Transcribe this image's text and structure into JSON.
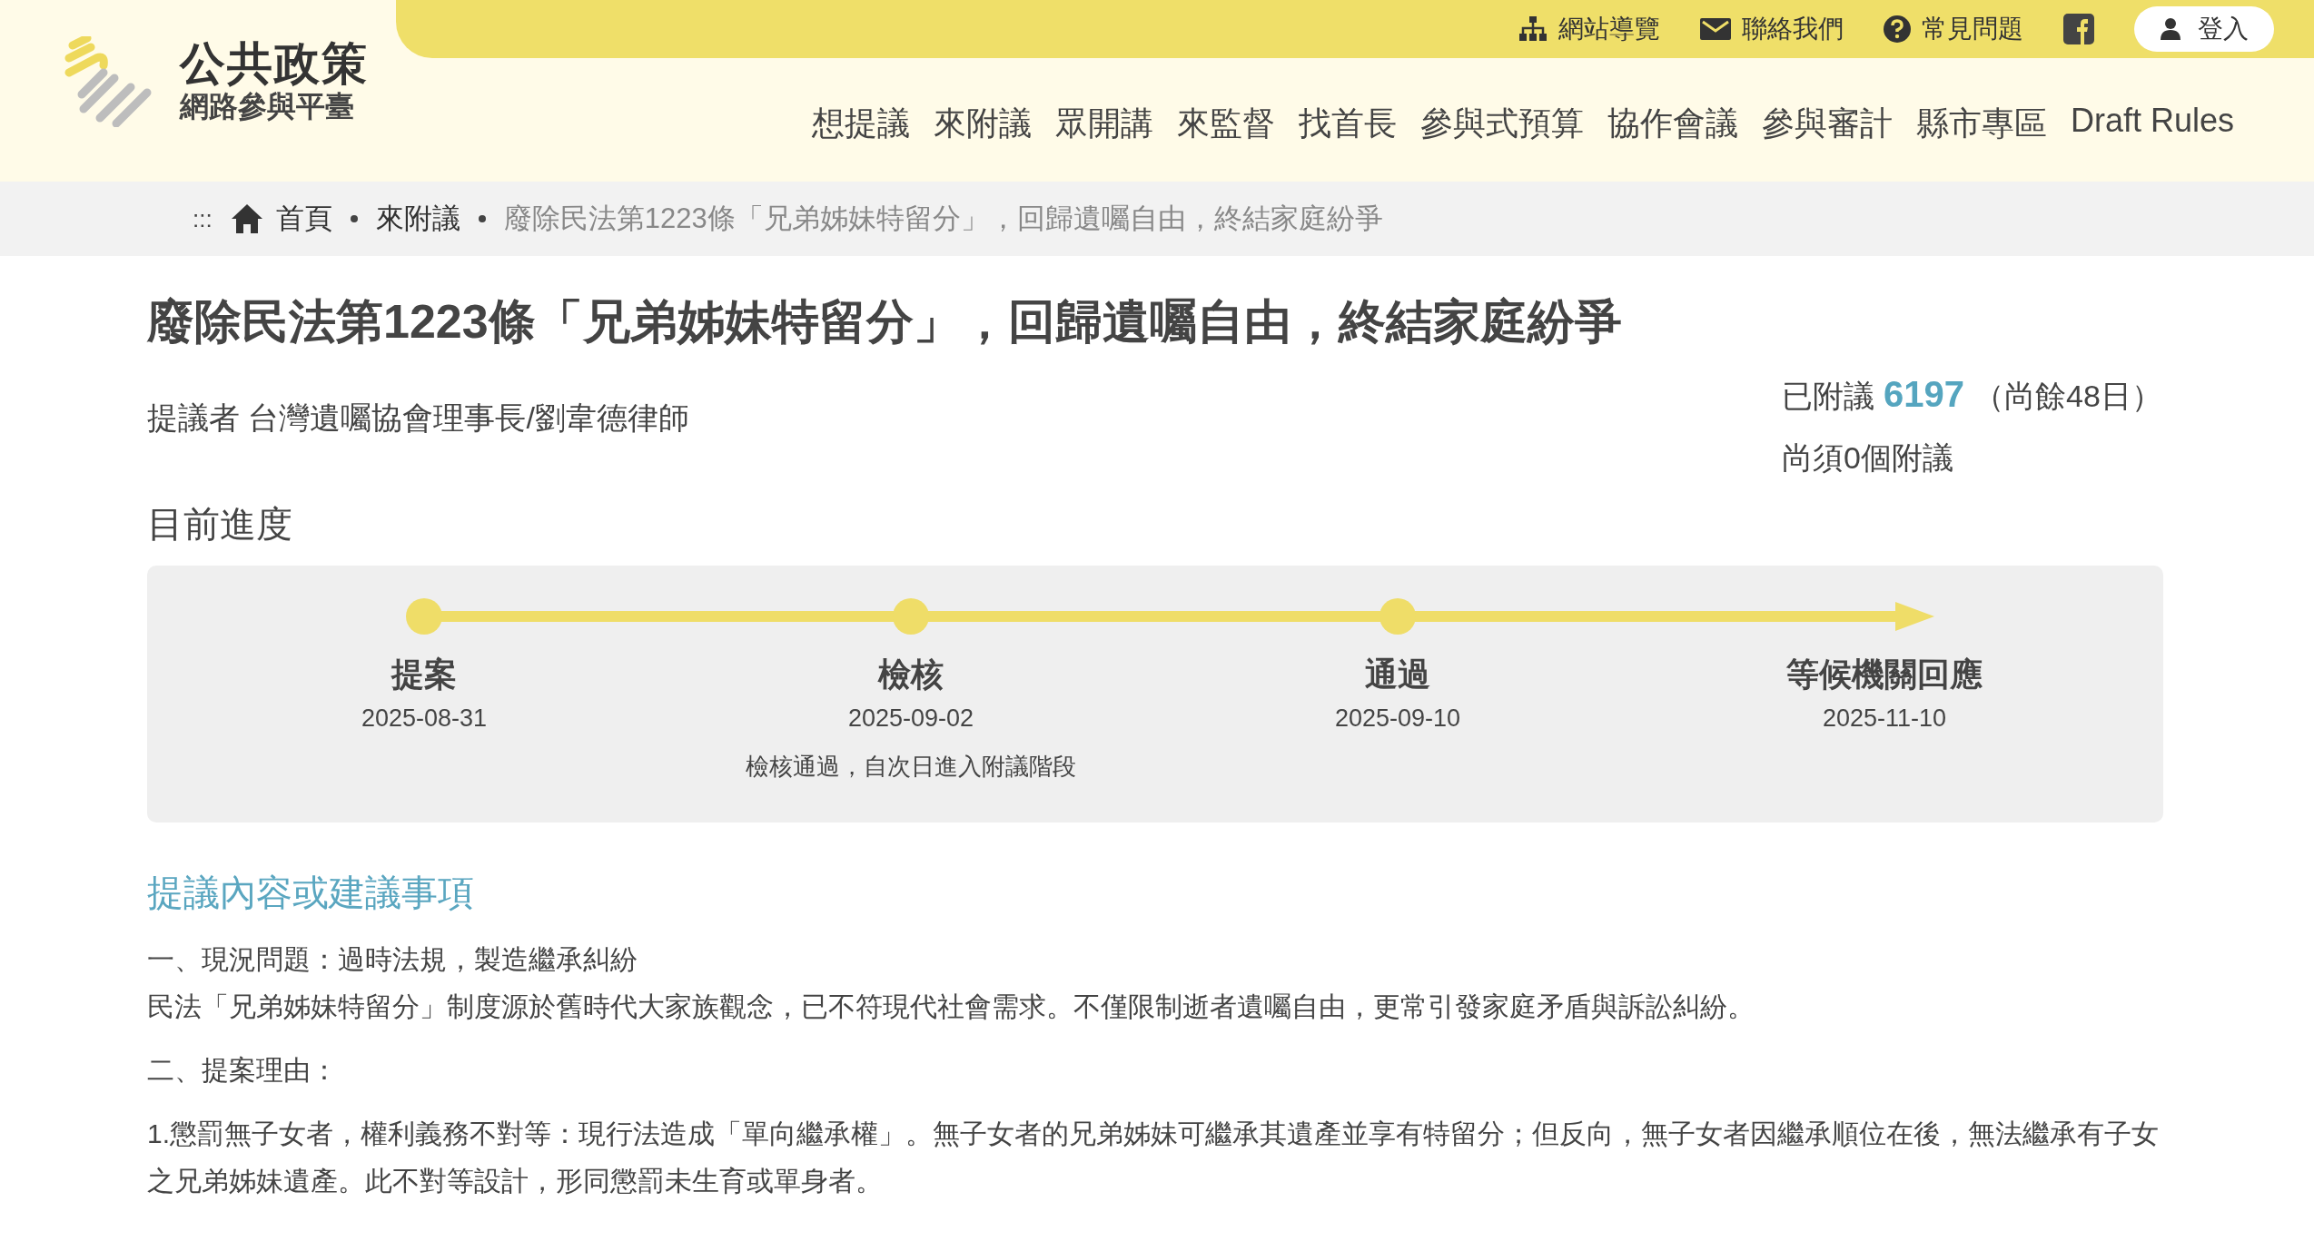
{
  "site": {
    "title": "公共政策",
    "subtitle": "網路參與平臺"
  },
  "top_links": [
    {
      "kind": "sitemap",
      "label": "網站導覽"
    },
    {
      "kind": "mail",
      "label": "聯絡我們"
    },
    {
      "kind": "help",
      "label": "常見問題"
    },
    {
      "kind": "facebook"
    },
    {
      "kind": "login",
      "label": "登入"
    }
  ],
  "nav": [
    "想提議",
    "來附議",
    "眾開講",
    "來監督",
    "找首長",
    "參與式預算",
    "協作會議",
    "參與審計",
    "縣市專區",
    "Draft Rules"
  ],
  "breadcrumb": {
    "separator": ":::",
    "items": [
      {
        "label": "首頁",
        "current": false
      },
      {
        "label": "來附議",
        "current": false
      },
      {
        "label": "廢除民法第1223條「兄弟姊妹特留分」，回歸遺囑自由，終結家庭紛爭",
        "current": true
      }
    ]
  },
  "proposal": {
    "title": "廢除民法第1223條「兄弟姊妹特留分」，回歸遺囑自由，終結家庭紛爭",
    "proposer": "提議者 台灣遺囑協會理事長/劉韋德律師",
    "seconded_label": "已附議",
    "seconded_count": "6197",
    "days_left": "（尚餘48日）",
    "needed": "尚須0個附議"
  },
  "progress": {
    "heading": "目前進度",
    "stages": [
      {
        "kind": "dot",
        "name": "提案",
        "date": "2025-08-31"
      },
      {
        "kind": "dot",
        "name": "檢核",
        "date": "2025-09-02",
        "note": "檢核通過，自次日進入附議階段"
      },
      {
        "kind": "dot",
        "name": "通過",
        "date": "2025-09-10"
      },
      {
        "kind": "arrow",
        "name": "等候機關回應",
        "date": "2025-11-10"
      }
    ]
  },
  "content": {
    "heading": "提議內容或建議事項",
    "paragraphs": [
      {
        "lines": [
          "一、現況問題：過時法規，製造繼承糾紛",
          "民法「兄弟姊妹特留分」制度源於舊時代大家族觀念，已不符現代社會需求。不僅限制逝者遺囑自由，更常引發家庭矛盾與訴訟糾紛。"
        ]
      },
      {
        "lines": [
          "二、提案理由："
        ]
      },
      {
        "lines": [
          "1.懲罰無子女者，權利義務不對等：現行法造成「單向繼承權」。無子女者的兄弟姊妹可繼承其遺產並享有特留分；但反向，無子女者因繼承順位在後，無法繼承有子女之兄弟姊妹遺產。此不對等設計，形同懲罰未生育或單身者。"
        ]
      }
    ]
  }
}
